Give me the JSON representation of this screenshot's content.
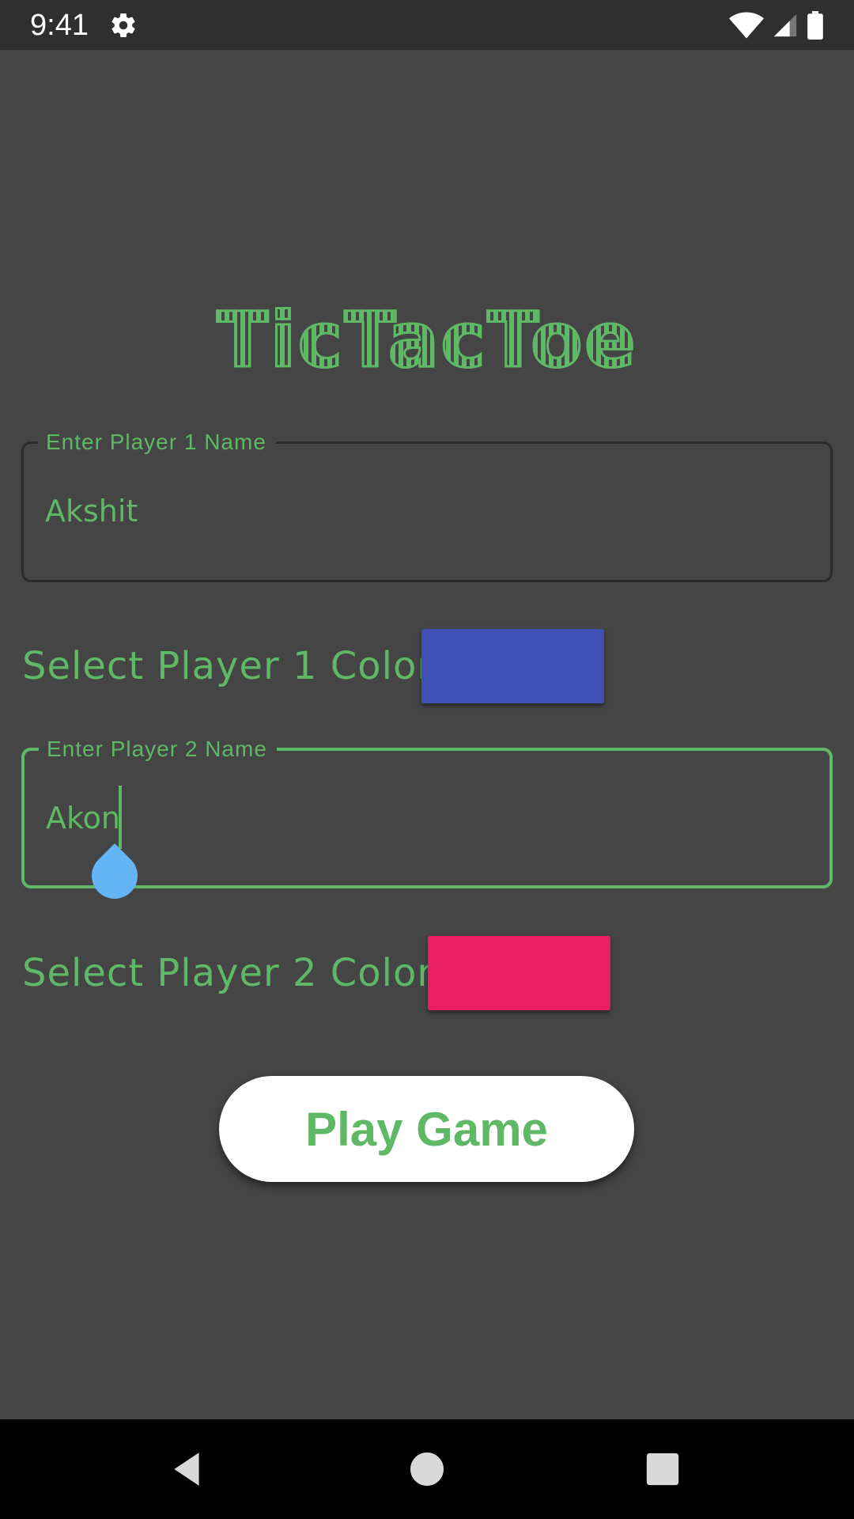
{
  "status_bar": {
    "time": "9:41",
    "icons": [
      "gear-icon",
      "wifi-icon",
      "signal-icon",
      "battery-icon"
    ]
  },
  "title": "TicTacToe",
  "player1": {
    "label": "Enter Player 1 Name",
    "value": "Akshit",
    "color_label": "Select Player 1 Color :",
    "color": "#3f51b5"
  },
  "player2": {
    "label": "Enter Player 2 Name",
    "value": "Akon",
    "color_label": "Select Player 2 Color :",
    "color": "#e91e63"
  },
  "play_button": "Play Game",
  "nav_bar": {
    "icons": [
      "back-icon",
      "home-icon",
      "recents-icon"
    ]
  },
  "colors": {
    "accent": "#5fb866",
    "background": "#454545",
    "cursor_handle": "#64b5f6"
  }
}
